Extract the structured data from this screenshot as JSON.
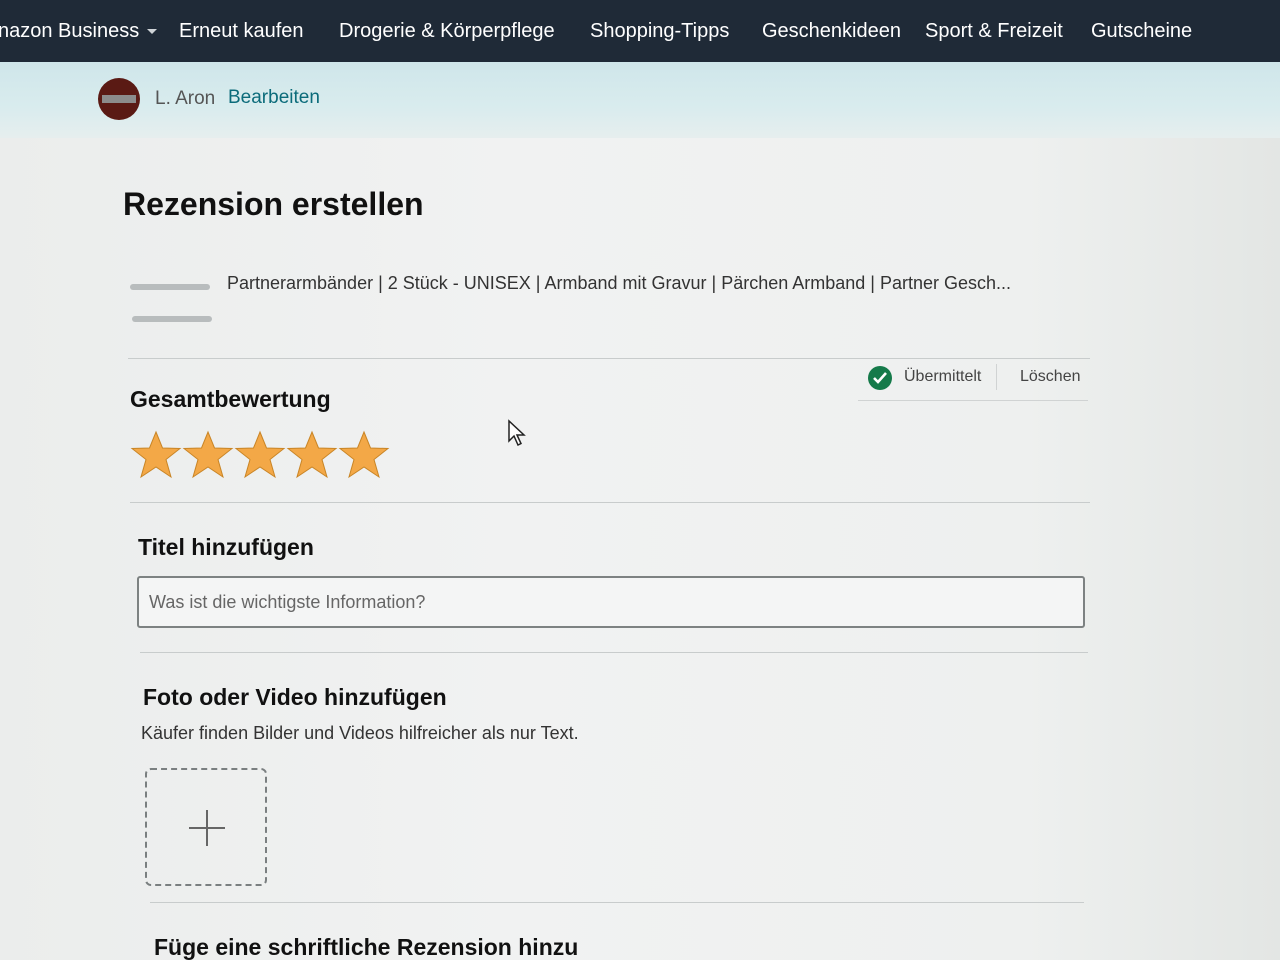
{
  "nav": {
    "items": [
      {
        "label": "nazon Business"
      },
      {
        "label": "Erneut kaufen"
      },
      {
        "label": "Drogerie & Körperpflege"
      },
      {
        "label": "Shopping-Tipps"
      },
      {
        "label": "Geschenkideen"
      },
      {
        "label": "Sport & Freizeit"
      },
      {
        "label": "Gutscheine"
      }
    ]
  },
  "profile": {
    "name": "L. Aron",
    "edit_label": "Bearbeiten"
  },
  "page": {
    "title": "Rezension erstellen"
  },
  "product": {
    "title": "Partnerarmbänder | 2 Stück - UNISEX | Armband mit Gravur | Pärchen Armband | Partner Gesch..."
  },
  "status": {
    "submitted_label": "Übermittelt",
    "delete_label": "Löschen"
  },
  "rating": {
    "heading": "Gesamtbewertung",
    "stars": 5,
    "max_stars": 5,
    "star_color": "#f3a847"
  },
  "title_section": {
    "heading": "Titel hinzufügen",
    "placeholder": "Was ist die wichtigste Information?"
  },
  "media_section": {
    "heading": "Foto oder Video hinzufügen",
    "hint": "Käufer finden Bilder und Videos hilfreicher als nur Text."
  },
  "written_section": {
    "heading": "Füge eine schriftliche Rezension hinzu"
  },
  "colors": {
    "nav_bg": "#1f2a37",
    "link": "#0b6b7a",
    "success": "#157a4a"
  }
}
